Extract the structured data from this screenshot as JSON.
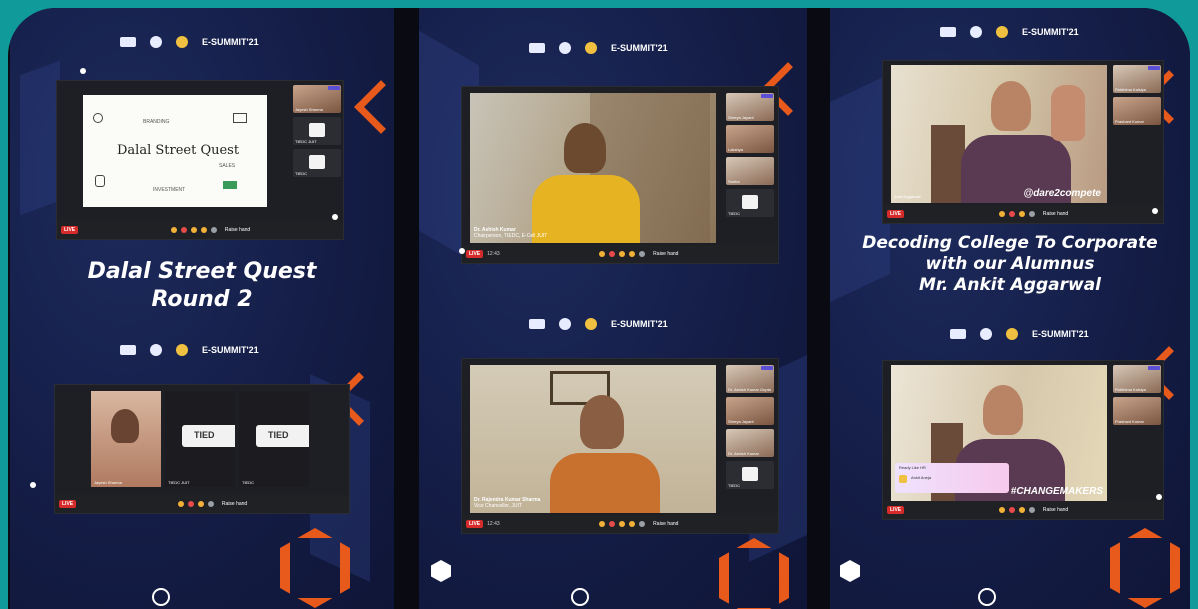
{
  "panels": {
    "left": {
      "logo_text": "E-SUMMIT'21",
      "slide_title": "Dalal Street Quest",
      "slide_doodles": [
        "BRANDING",
        "SALES",
        "INVESTMENT",
        "CASH FLOW"
      ],
      "headline_line1": "Dalal Street Quest",
      "headline_line2": "Round 2",
      "top_tiles": [
        "Jayesh Sharma",
        "TIEDC JUIT",
        "TIEDC"
      ],
      "bottom_tiles": [
        {
          "name": "Jayesh Sharma",
          "sub": "Student JUIT Waknaghat"
        },
        {
          "name": "TIEDC JUIT",
          "sub": "E-Cell JUIT"
        },
        {
          "name": "TIEDC",
          "sub": "E-Cell JUIT"
        }
      ],
      "raise_label": "Raise hand"
    },
    "middle": {
      "logo_text": "E-SUMMIT'21",
      "top_speaker": {
        "name": "Dr. Ashish Kumar",
        "role": "Chairperson, TIEDC, E-Cell JUIT"
      },
      "top_tiles": [
        "Shreya Jayant",
        "Lakshya",
        "Sneha",
        "TIEDC"
      ],
      "bottom_speaker": {
        "name": "Dr. Rajendra Kumar Sharma",
        "role": "Vice Chancellor, JUIT"
      },
      "bottom_tiles": [
        "Dr. Ashish Kumar Gupta",
        "Shreya Jayant",
        "Dr. Ashish Kumar",
        "TIEDC"
      ],
      "time_label": "12:43",
      "raise_label": "Raise hand"
    },
    "right": {
      "logo_text": "E-SUMMIT'21",
      "top_overlay": "@dare2compete",
      "speaker_name": "Ankit Aggarwal",
      "headline_line1": "Decoding College To Corporate",
      "headline_line2": "with our Alumnus",
      "headline_line3": "Mr. Ankit Aggarwal",
      "bottom_overlay": "#CHANGEMAKERS",
      "notification_title": "Ready Like HR",
      "notification_body": "Ankit Aneja",
      "top_tiles": [
        "Riddhima Kalsiya",
        "Prashant Kumar"
      ],
      "raise_label": "Raise hand"
    }
  },
  "colors": {
    "background": "#109a9a",
    "panel": "#141d46",
    "accent": "#e85a1c",
    "live": "#d62b2b"
  }
}
